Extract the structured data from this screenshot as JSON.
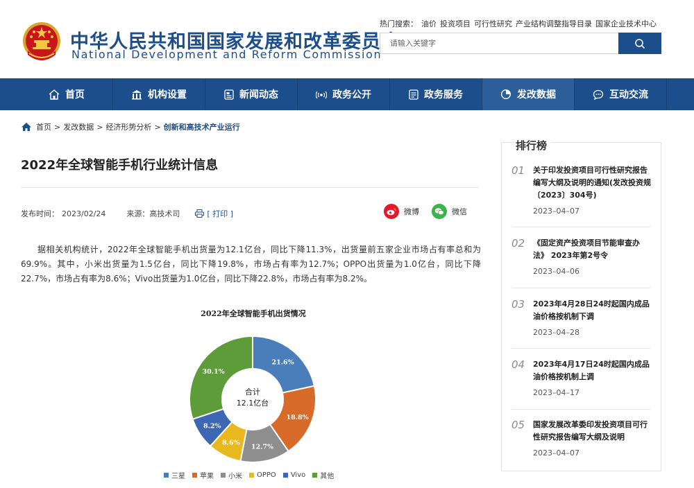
{
  "site": {
    "title_cn": "中华人民共和国国家发展和改革委员会",
    "title_en": "National Development and Reform Commission"
  },
  "hot_search": {
    "label": "热门搜索：",
    "links": [
      "油价",
      "投资项目",
      "可行性研究",
      "产业结构调整指导目录",
      "国家企业技术中心"
    ]
  },
  "search": {
    "placeholder": "请输入关键字"
  },
  "nav": {
    "items": [
      {
        "label": "首页",
        "icon": "home-icon"
      },
      {
        "label": "机构设置",
        "icon": "building-icon"
      },
      {
        "label": "新闻动态",
        "icon": "news-icon"
      },
      {
        "label": "政务公开",
        "icon": "broadcast-icon"
      },
      {
        "label": "政务服务",
        "icon": "document-icon"
      },
      {
        "label": "发改数据",
        "icon": "pie-chart-icon",
        "active": true
      },
      {
        "label": "互动交流",
        "icon": "chat-icon"
      }
    ]
  },
  "breadcrumb": [
    "首页",
    "发改数据",
    "经济形势分析",
    "创新和高技术产业运行"
  ],
  "article": {
    "title": "2022年全球智能手机行业统计信息",
    "publish_label": "发布时间：",
    "publish_date": "2023/02/24",
    "source": "来源：高技术司",
    "print": "[ 打印 ]",
    "share_weibo": "微博",
    "share_weixin": "微信",
    "body": "据相关机构统计，2022年全球智能手机出货量为12.1亿台，同比下降11.3%，出货量前五家企业市场占有率总和为69.9%。其中，小米出货量为1.5亿台，同比下降19.8%，市场占有率为12.7%；OPPO出货量为1.0亿台，同比下降22.7%，市场占有率为8.6%；Vivo出货量为1.0亿台，同比下降22.8%，市场占有率为8.2%。"
  },
  "chart_data": {
    "type": "pie",
    "title": "2022年全球智能手机出货情况",
    "center_label_line1": "合计",
    "center_label_line2": "12.1亿台",
    "categories": [
      "三星",
      "苹果",
      "小米",
      "OPPO",
      "Vivo",
      "其他"
    ],
    "values": [
      21.6,
      18.8,
      12.7,
      8.6,
      8.2,
      30.1
    ],
    "data_labels": [
      "21.6%",
      "18.8%",
      "12.7%",
      "8.6%",
      "8.2%",
      "30.1%"
    ],
    "colors": [
      "#4a7ebb",
      "#d96b2a",
      "#8e8e8e",
      "#e8b81f",
      "#3d66b3",
      "#5e9c3a"
    ],
    "legend_position": "bottom"
  },
  "sidebar": {
    "title": "排行榜",
    "items": [
      {
        "num": "01",
        "text": "关于印发投资项目可行性研究报告编写大纲及说明的通知(发改投资规〔2023〕304号)",
        "date": "2023–04–07"
      },
      {
        "num": "02",
        "text": "《固定资产投资项目节能审查办法》 2023年第2号令",
        "date": "2023–04–06"
      },
      {
        "num": "03",
        "text": "2023年4月28日24时起国内成品油价格按机制下调",
        "date": "2023–04–28"
      },
      {
        "num": "04",
        "text": "2023年4月17日24时起国内成品油价格按机制上调",
        "date": "2023–04–17"
      },
      {
        "num": "05",
        "text": "国家发展改革委印发投资项目可行性研究报告编写大纲及说明",
        "date": "2023–04–07"
      }
    ]
  }
}
